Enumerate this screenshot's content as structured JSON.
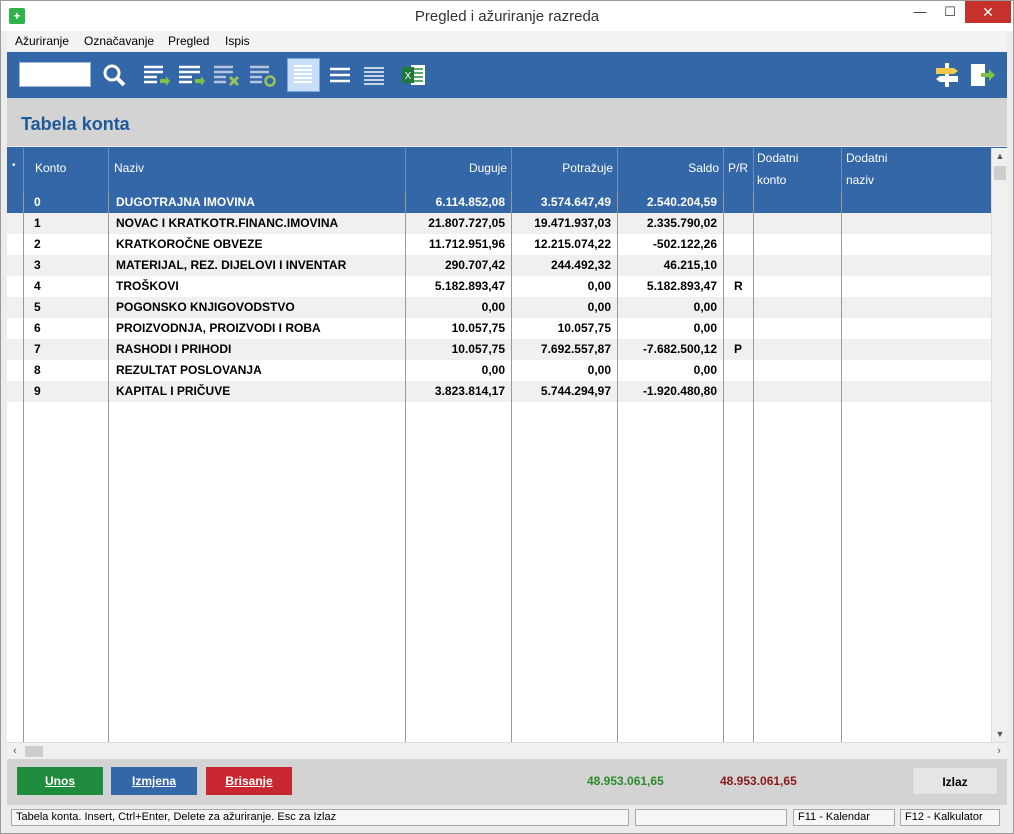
{
  "window": {
    "title": "Pregled i ažuriranje razreda",
    "minimize": "—",
    "maximize": "☐",
    "close": "✕",
    "app_icon": "+"
  },
  "menu": [
    {
      "label": "Ažuriranje"
    },
    {
      "label": "Označavanje"
    },
    {
      "label": "Pregled"
    },
    {
      "label": "Ispis"
    }
  ],
  "toolbar": {
    "search_value": "",
    "icons": [
      "search-icon",
      "list-add-icon",
      "list-edit-icon",
      "list-delete-icon",
      "list-refresh-icon",
      "view-list-selected-icon",
      "view-list-icon",
      "view-list-compact-icon",
      "excel-icon",
      "signpost-icon",
      "exit-icon"
    ]
  },
  "page_title": "Tabela konta",
  "columns": {
    "marker": "•",
    "konto": "Konto",
    "naziv": "Naziv",
    "duguje": "Duguje",
    "potrazuje": "Potražuje",
    "saldo": "Saldo",
    "pr": "P/R",
    "dodatni_konto_1": "Dodatni",
    "dodatni_konto_2": "konto",
    "dodatni_naziv_1": "Dodatni",
    "dodatni_naziv_2": "naziv"
  },
  "rows": [
    {
      "konto": "0",
      "naziv": "DUGOTRAJNA IMOVINA",
      "duguje": "6.114.852,08",
      "potrazuje": "3.574.647,49",
      "saldo": "2.540.204,59",
      "pr": "",
      "selected": true
    },
    {
      "konto": "1",
      "naziv": "NOVAC I KRATKOTR.FINANC.IMOVINA",
      "duguje": "21.807.727,05",
      "potrazuje": "19.471.937,03",
      "saldo": "2.335.790,02",
      "pr": ""
    },
    {
      "konto": "2",
      "naziv": "KRATKOROČNE OBVEZE",
      "duguje": "11.712.951,96",
      "potrazuje": "12.215.074,22",
      "saldo": "-502.122,26",
      "pr": ""
    },
    {
      "konto": "3",
      "naziv": "MATERIJAL, REZ. DIJELOVI I INVENTAR",
      "duguje": "290.707,42",
      "potrazuje": "244.492,32",
      "saldo": "46.215,10",
      "pr": ""
    },
    {
      "konto": "4",
      "naziv": "TROŠKOVI",
      "duguje": "5.182.893,47",
      "potrazuje": "0,00",
      "saldo": "5.182.893,47",
      "pr": "R"
    },
    {
      "konto": "5",
      "naziv": "POGONSKO KNJIGOVODSTVO",
      "duguje": "0,00",
      "potrazuje": "0,00",
      "saldo": "0,00",
      "pr": ""
    },
    {
      "konto": "6",
      "naziv": "PROIZVODNJA, PROIZVODI I ROBA",
      "duguje": "10.057,75",
      "potrazuje": "10.057,75",
      "saldo": "0,00",
      "pr": ""
    },
    {
      "konto": "7",
      "naziv": "RASHODI I PRIHODI",
      "duguje": "10.057,75",
      "potrazuje": "7.692.557,87",
      "saldo": "-7.682.500,12",
      "pr": "P"
    },
    {
      "konto": "8",
      "naziv": "REZULTAT POSLOVANJA",
      "duguje": "0,00",
      "potrazuje": "0,00",
      "saldo": "0,00",
      "pr": ""
    },
    {
      "konto": "9",
      "naziv": "KAPITAL I PRIČUVE",
      "duguje": "3.823.814,17",
      "potrazuje": "5.744.294,97",
      "saldo": "-1.920.480,80",
      "pr": ""
    }
  ],
  "buttons": {
    "unos": "Unos",
    "izmjena": "Izmjena",
    "brisanje": "Brisanje",
    "izlaz": "Izlaz"
  },
  "totals": {
    "duguje": "48.953.061,65",
    "potrazuje": "48.953.061,65"
  },
  "colors": {
    "accent": "#3467a7",
    "unos": "#1e8c3c",
    "brisanje": "#c9272f",
    "total_duguje": "#2d8a2d",
    "total_potrazuje": "#8b1a1a"
  },
  "status": {
    "hint": "Tabela konta. Insert, Ctrl+Enter, Delete za ažuriranje. Esc za Izlaz",
    "empty": "",
    "f11": "F11 - Kalendar",
    "f12": "F12 - Kalkulator"
  }
}
